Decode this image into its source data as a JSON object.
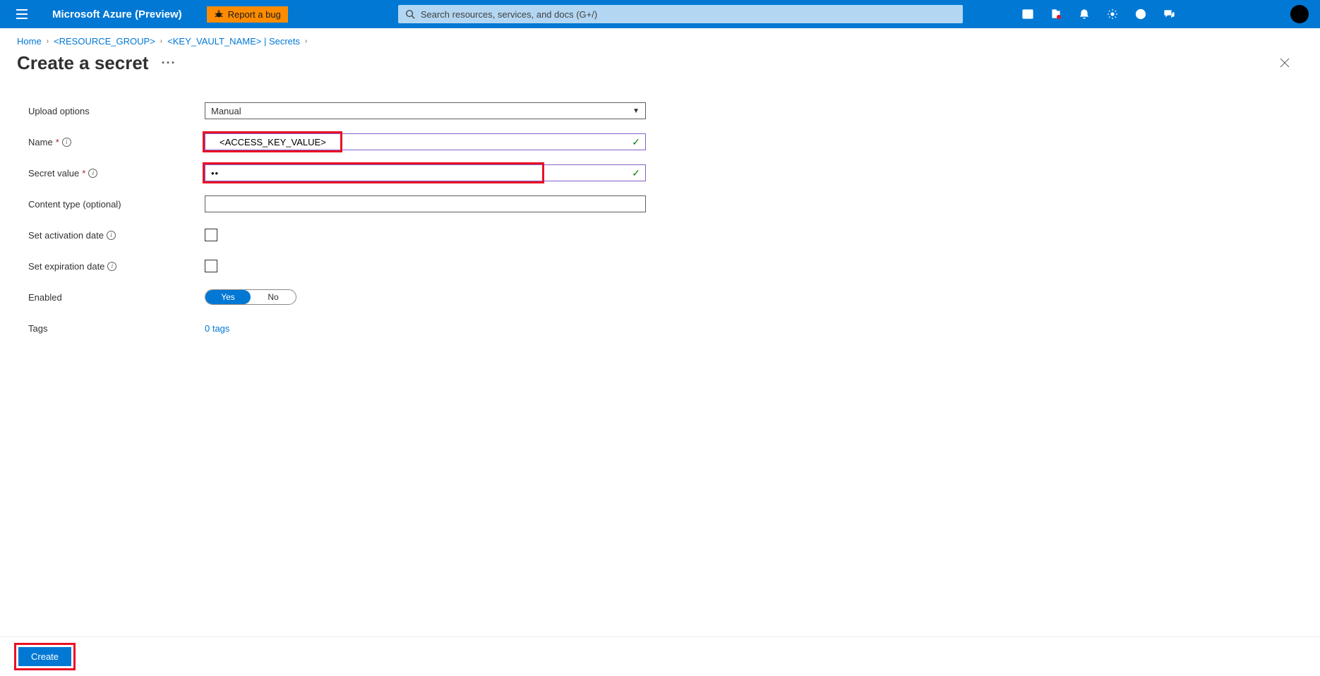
{
  "header": {
    "brand": "Microsoft Azure (Preview)",
    "report_bug": "Report a bug",
    "search_placeholder": "Search resources, services, and docs (G+/)"
  },
  "breadcrumb": {
    "home": "Home",
    "rg": "<RESOURCE_GROUP>",
    "kv": "<KEY_VAULT_NAME>",
    "secrets": "Secrets"
  },
  "page": {
    "title": "Create a secret",
    "more": "···"
  },
  "form": {
    "upload_options_label": "Upload options",
    "upload_options_value": "Manual",
    "name_label": "Name",
    "name_value": "<ACCESS_KEY_VALUE>",
    "secret_label": "Secret value",
    "secret_value": "••",
    "content_type_label": "Content type (optional)",
    "content_type_value": "",
    "activation_label": "Set activation date",
    "expiration_label": "Set expiration date",
    "enabled_label": "Enabled",
    "toggle_yes": "Yes",
    "toggle_no": "No",
    "tags_label": "Tags",
    "tags_link": "0 tags"
  },
  "footer": {
    "create": "Create"
  }
}
